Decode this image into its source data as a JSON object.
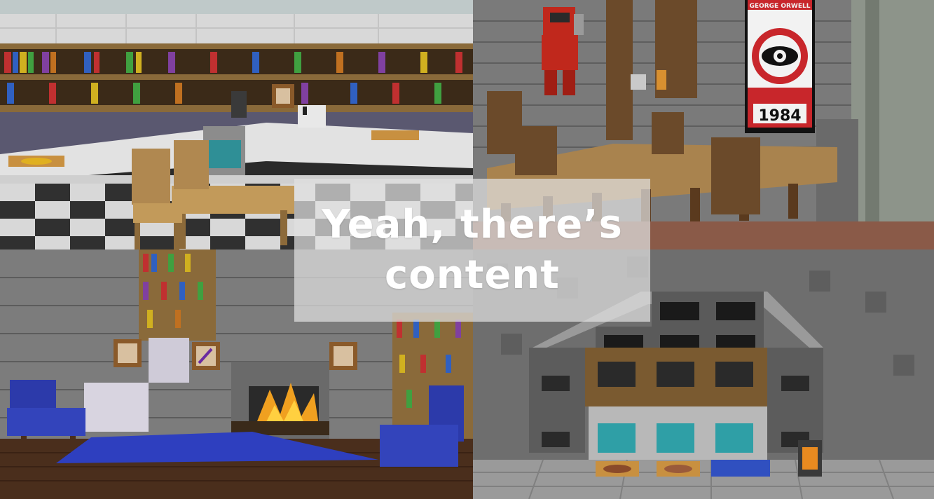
{
  "caption": {
    "line1": "Yeah, there’s",
    "line2": "content"
  },
  "poster": {
    "year": "1984",
    "banner": "GEORGE ORWELL"
  },
  "colors": {
    "overlay_bg": "#e1e1e1",
    "caption_text": "#ffffff",
    "poster_red": "#c8262b"
  }
}
